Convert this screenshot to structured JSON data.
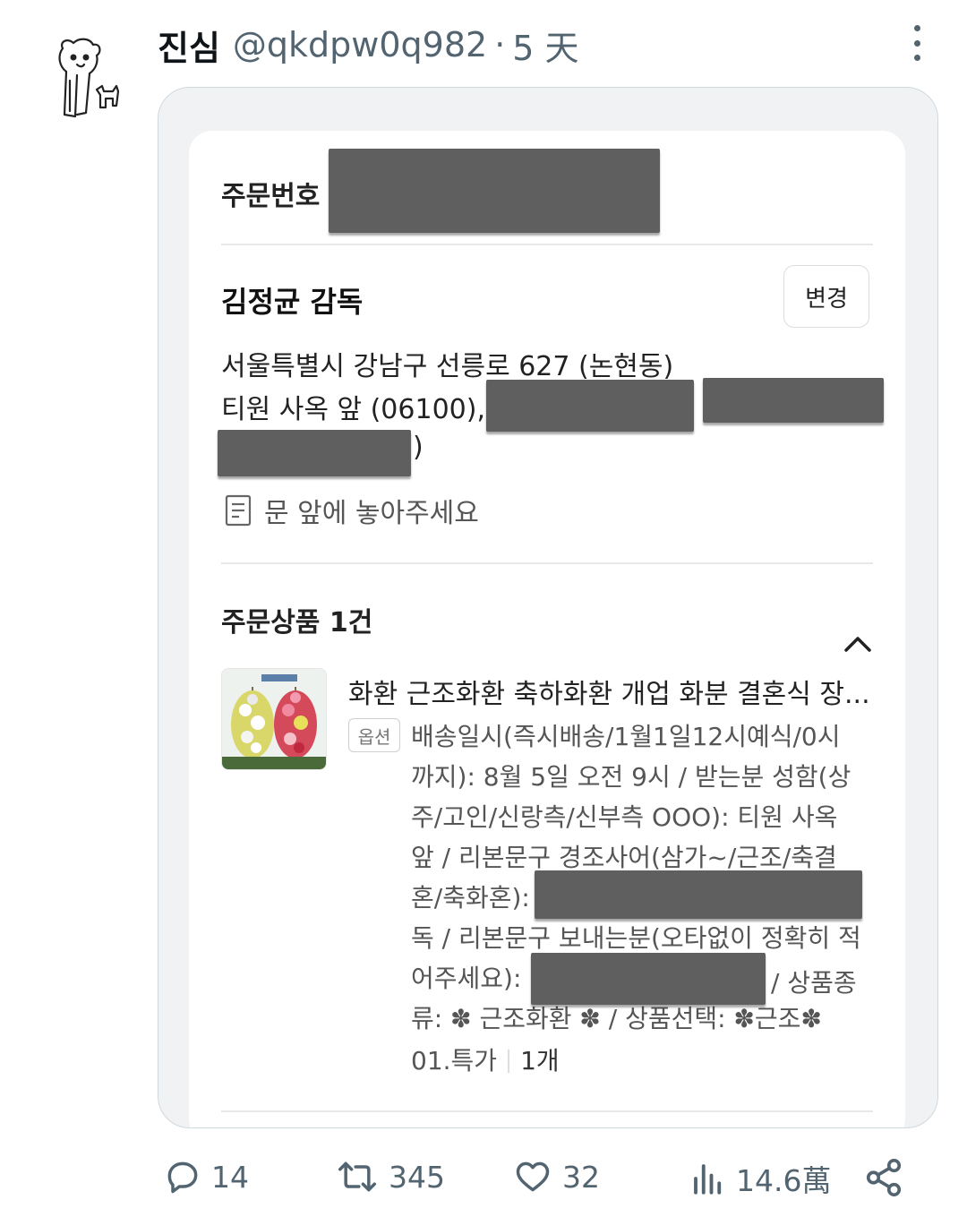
{
  "post": {
    "display_name": "진심",
    "handle": "@qkdpw0q982",
    "separator": "·",
    "time": "5 天"
  },
  "card": {
    "order_number_label": "주문번호",
    "recipient_name": "김정균 감독",
    "change_button": "변경",
    "address_line1": "서울특별시 강남구 선릉로 627 (논현동)",
    "address_line2": "티원 사옥 앞 (06100),",
    "address_line3_tail": ")",
    "delivery_note": "문 앞에 놓아주세요",
    "items_title": "주문상품 1건",
    "product_title": "화환 근조화환 축하화환 개업 화분 결혼식 장...",
    "option_badge": "옵션",
    "option_lines": [
      "배송일시(즉시배송/1월1일12시예식/0시",
      "까지): 8월 5일 오전 9시 / 받는분 성함(상",
      "주/고인/신랑측/신부측 OOO): 티원 사옥",
      "앞 / 리본문구 경조사어(삼가~/근조/축결",
      "혼/축화혼):",
      "독 / 리본문구 보내는분(오타없이 정확히 적",
      "어주세요):",
      "류: ✽ 근조화환 ✽ / 상품선택: ✽근조✽"
    ],
    "option_line5_tail": "/ 상품종",
    "option_last": "01.특가",
    "quantity": "1개"
  },
  "actions": {
    "replies": "14",
    "reposts": "345",
    "likes": "32",
    "views": "14.6萬"
  },
  "icons": {
    "reply": "reply-icon",
    "repost": "repost-icon",
    "like": "heart-icon",
    "views": "views-icon",
    "share": "share-icon",
    "more": "more-vertical-icon",
    "note": "memo-icon",
    "collapse": "chevron-up-icon"
  },
  "colors": {
    "redaction": "#5f5f5f",
    "secondary_text": "#536471"
  }
}
